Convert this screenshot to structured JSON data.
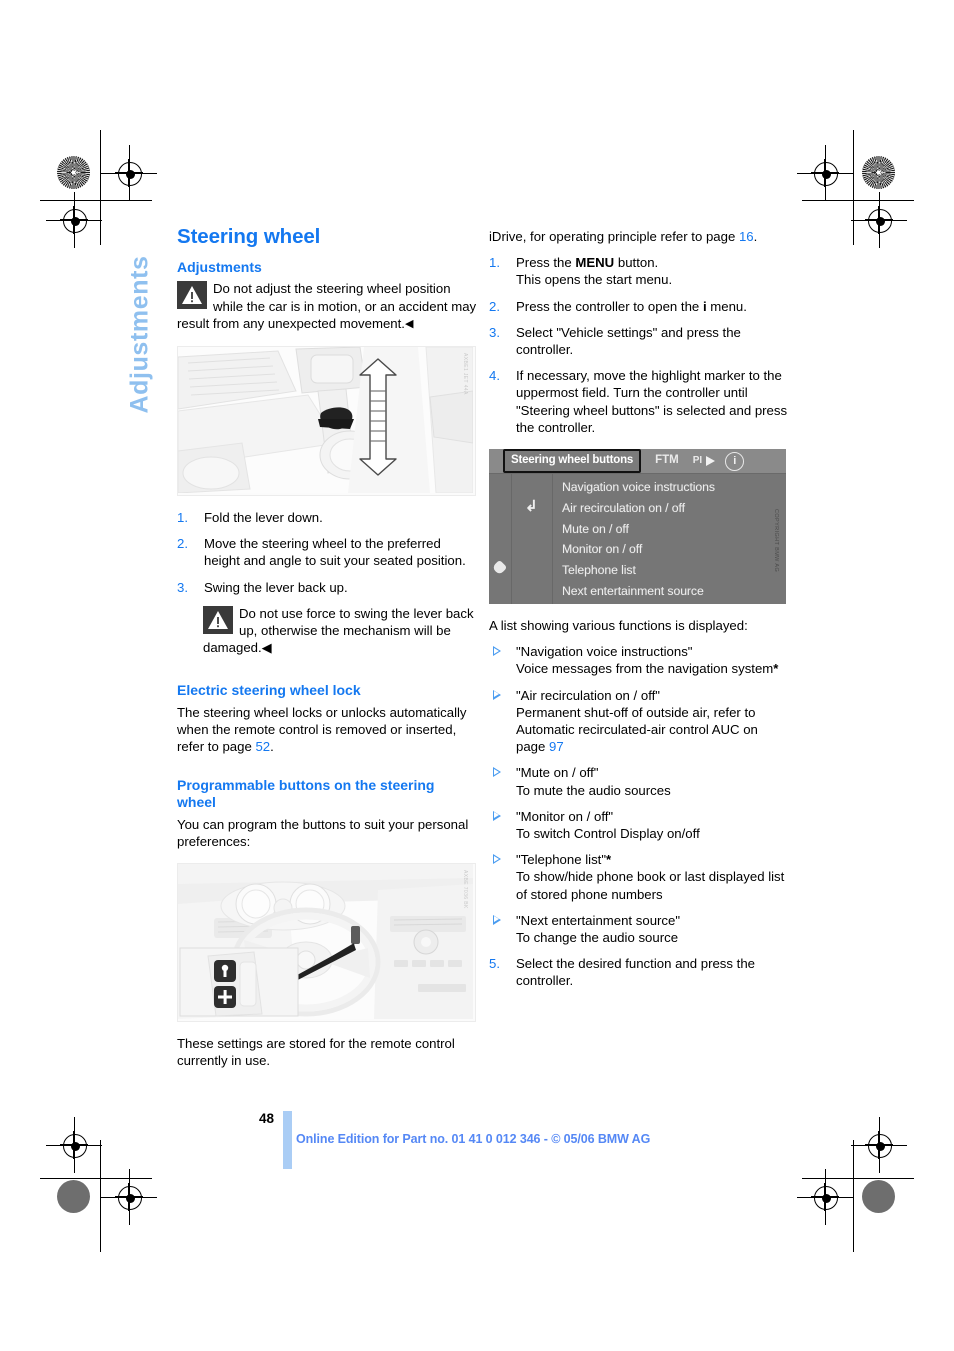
{
  "sidetab": {
    "label": "Adjustments"
  },
  "left": {
    "title": "Steering wheel",
    "adjustments_heading": "Adjustments",
    "warning_1": "Do not adjust the steering wheel position while the car is in motion, or an accident may result from any unexpected movement.",
    "warning_end_mark": "◀",
    "figure_lever_credit": "AXBE1 JET 44A",
    "steps": [
      {
        "num": "1.",
        "text": "Fold the lever down."
      },
      {
        "num": "2.",
        "text": "Move the steering wheel to the preferred height and angle to suit your seated position."
      },
      {
        "num": "3.",
        "text": "Swing the lever back up."
      }
    ],
    "warning_2": "Do not use force to swing the lever back up, otherwise the mechanism will be damaged.",
    "lock_heading": "Electric steering wheel lock",
    "lock_text_a": "The steering wheel locks or unlocks automatically when the remote control is removed or inserted, refer to page ",
    "lock_page_link": "52",
    "lock_text_b": ".",
    "prog_heading": "Programmable buttons on the steering wheel",
    "prog_intro": "You can program the buttons to suit your personal preferences:",
    "figure_wheel_credit": "AXBE 7036 BK",
    "closing": "These settings are stored for the remote control currently in use."
  },
  "right": {
    "intro_a": "iDrive, for operating principle refer to page ",
    "intro_link": "16",
    "intro_b": ".",
    "steps": [
      {
        "num": "1.",
        "pre": "Press the ",
        "strong": "MENU",
        "post": " button.",
        "second_line": "This opens the start menu."
      },
      {
        "num": "2.",
        "pre": "Press the controller to open the ",
        "strong": "i",
        "post": " menu.",
        "second_line": ""
      },
      {
        "num": "3.",
        "pre": "Select \"Vehicle settings\" and press the controller.",
        "strong": "",
        "post": "",
        "second_line": ""
      },
      {
        "num": "4.",
        "pre": "If necessary, move the highlight marker to the uppermost field. Turn the controller until \"Steering wheel buttons\" is selected and press the controller.",
        "strong": "",
        "post": "",
        "second_line": ""
      }
    ],
    "idrive": {
      "title": "Steering wheel buttons",
      "ftm": "FTM",
      "pi": "PI",
      "info_icon": "i",
      "credit": "COPYRIGHT BMW AG",
      "items": [
        "Navigation voice instructions",
        "Air recirculation on / off",
        "Mute on / off",
        "Monitor on / off",
        "Telephone list",
        "Next entertainment source"
      ]
    },
    "list_intro": "A list showing various functions is displayed:",
    "bullets": [
      {
        "title": "\"Navigation voice instructions\"",
        "desc": "Voice messages from the navigation system",
        "star": "*",
        "link": "",
        "link_pre": "",
        "link_post": ""
      },
      {
        "title": "\"Air recirculation on / off\"",
        "desc": "Permanent shut-off of outside air, refer to Automatic recirculated-air control AUC on page ",
        "star": "",
        "link": "97",
        "link_pre": "",
        "link_post": ""
      },
      {
        "title": "\"Mute on / off\"",
        "desc": "To mute the audio sources",
        "star": "",
        "link": "",
        "link_pre": "",
        "link_post": ""
      },
      {
        "title": "\"Monitor on / off\"",
        "desc": "To switch Control Display on/off",
        "star": "",
        "link": "",
        "link_pre": "",
        "link_post": ""
      },
      {
        "title": "\"Telephone list\"",
        "desc": "To show/hide phone book or last displayed list of stored phone numbers",
        "star": "*",
        "link": "",
        "link_pre": "",
        "link_post": ""
      },
      {
        "title": "\"Next entertainment source\"",
        "desc": "To change the audio source",
        "star": "",
        "link": "",
        "link_pre": "",
        "link_post": ""
      }
    ],
    "final_step": {
      "num": "5.",
      "text": "Select the desired function and press the controller."
    }
  },
  "footer": {
    "page_number": "48",
    "text": "Online Edition for Part no. 01 41 0 012 346 - © 05/06 BMW AG"
  },
  "colors": {
    "accent_blue": "#1478f0",
    "tab_blue": "#8fc0ef",
    "footer_blue": "#5588f5"
  }
}
